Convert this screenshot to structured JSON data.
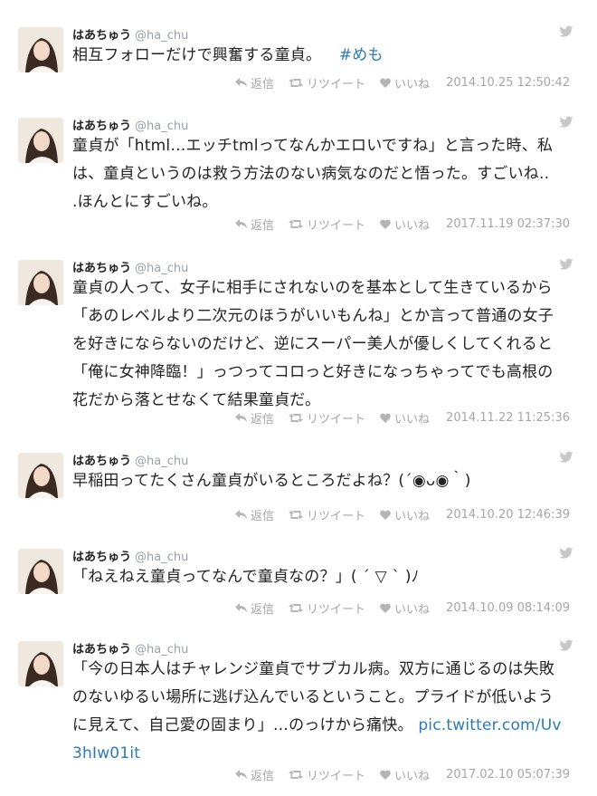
{
  "colors": {
    "link": "#2b7bb9",
    "muted": "#a6a6a6",
    "text": "#222222"
  },
  "tweets": [
    {
      "name": "はあちゅう",
      "handle": "@ha_chu",
      "lines": [
        "相互フォローだけで興奮する童貞。"
      ],
      "hashtag": "#めも",
      "link": "",
      "reply": "返信",
      "retweet": "リツイート",
      "like": "いいね",
      "timestamp": "2014.10.25 12:50:42"
    },
    {
      "name": "はあちゅう",
      "handle": "@ha_chu",
      "lines": [
        "童貞が「html…エッチtmlってなんかエロいですね」と言った時、私",
        "は、童貞というのは救う方法のない病気なのだと悟った。すごいね..",
        ".ほんとにすごいね。"
      ],
      "hashtag": "",
      "link": "",
      "reply": "返信",
      "retweet": "リツイート",
      "like": "いいね",
      "timestamp": "2017.11.19 02:37:30"
    },
    {
      "name": "はあちゅう",
      "handle": "@ha_chu",
      "lines": [
        "童貞の人って、女子に相手にされないのを基本として生きているから",
        "「あのレベルより二次元のほうがいいもんね」とか言って普通の女子",
        "を好きにならないのだけど、逆にスーパー美人が優しくしてくれると",
        "「俺に女神降臨！」っつってコロっと好きになっちゃってでも高根の",
        "花だから落とせなくて結果童貞だ。"
      ],
      "hashtag": "",
      "link": "",
      "reply": "返信",
      "retweet": "リツイート",
      "like": "いいね",
      "timestamp": "2014.11.22 11:25:36"
    },
    {
      "name": "はあちゅう",
      "handle": "@ha_chu",
      "lines": [
        "早稲田ってたくさん童貞がいるところだよね？(´◉ᴗ◉｀)"
      ],
      "hashtag": "",
      "link": "",
      "reply": "返信",
      "retweet": "リツイート",
      "like": "いいね",
      "timestamp": "2014.10.20 12:46:39"
    },
    {
      "name": "はあちゅう",
      "handle": "@ha_chu",
      "lines": [
        "「ねえねえ童貞ってなんで童貞なの？」( ´ ▽ ` )ﾉ"
      ],
      "hashtag": "",
      "link": "",
      "reply": "返信",
      "retweet": "リツイート",
      "like": "いいね",
      "timestamp": "2014.10.09 08:14:09"
    },
    {
      "name": "はあちゅう",
      "handle": "@ha_chu",
      "lines": [
        "「今の日本人はチャレンジ童貞でサブカル病。双方に通じるのは失敗",
        "のないゆるい場所に逃げ込んでいるということ。プライドが低いよう",
        "に見えて、自己愛の固まり」…のっけから痛快。"
      ],
      "hashtag": "",
      "link": "pic.twitter.com/Uv3hIw01it",
      "link_line1": "pic.twitter.com/Uv",
      "link_line2": "3hIw01it",
      "reply": "返信",
      "retweet": "リツイート",
      "like": "いいね",
      "timestamp": "2017.02.10 05:07:39"
    }
  ]
}
